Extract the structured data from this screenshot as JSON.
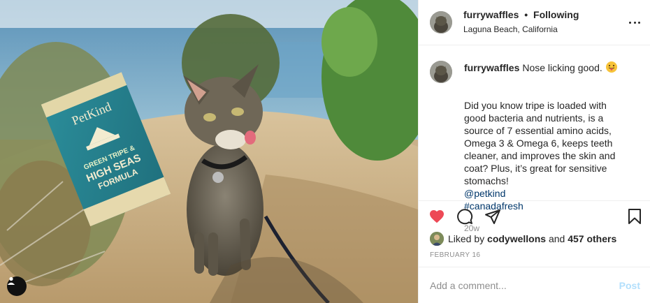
{
  "post": {
    "username": "furrywaffles",
    "separator": "•",
    "follow_status": "Following",
    "location": "Laguna Beach, California"
  },
  "caption": {
    "username": "furrywaffles",
    "headline": "Nose licking good.",
    "emoji_icon": "tongue-emoji",
    "body_text": "Did you know tripe is loaded with good bacteria and nutrients, is a source of 7 essential amino acids, Omega 3 & Omega 6, keeps teeth cleaner, and improves the skin and coat? Plus, it’s great for sensitive stomachs!",
    "mention": "@petkind",
    "hashtag": "#canadafresh",
    "time_ago": "20w"
  },
  "actions": {
    "like_icon": "heart-icon",
    "like_color": "#ed4956",
    "comment_icon": "comment-icon",
    "share_icon": "share-icon",
    "save_icon": "bookmark-icon"
  },
  "likes": {
    "prefix": "Liked by",
    "user": "codywellons",
    "joiner": "and",
    "others": "457 others"
  },
  "date": "FEBRUARY 16",
  "comment_box": {
    "placeholder": "Add a comment...",
    "post_label": "Post"
  },
  "photo": {
    "package_brand": "PetKind",
    "package_text": "GREEN TRIPE & HIGH SEAS FORMULA"
  },
  "colors": {
    "link": "#00376b",
    "muted": "#8e8e8e",
    "post_disabled": "#b2dffc"
  }
}
